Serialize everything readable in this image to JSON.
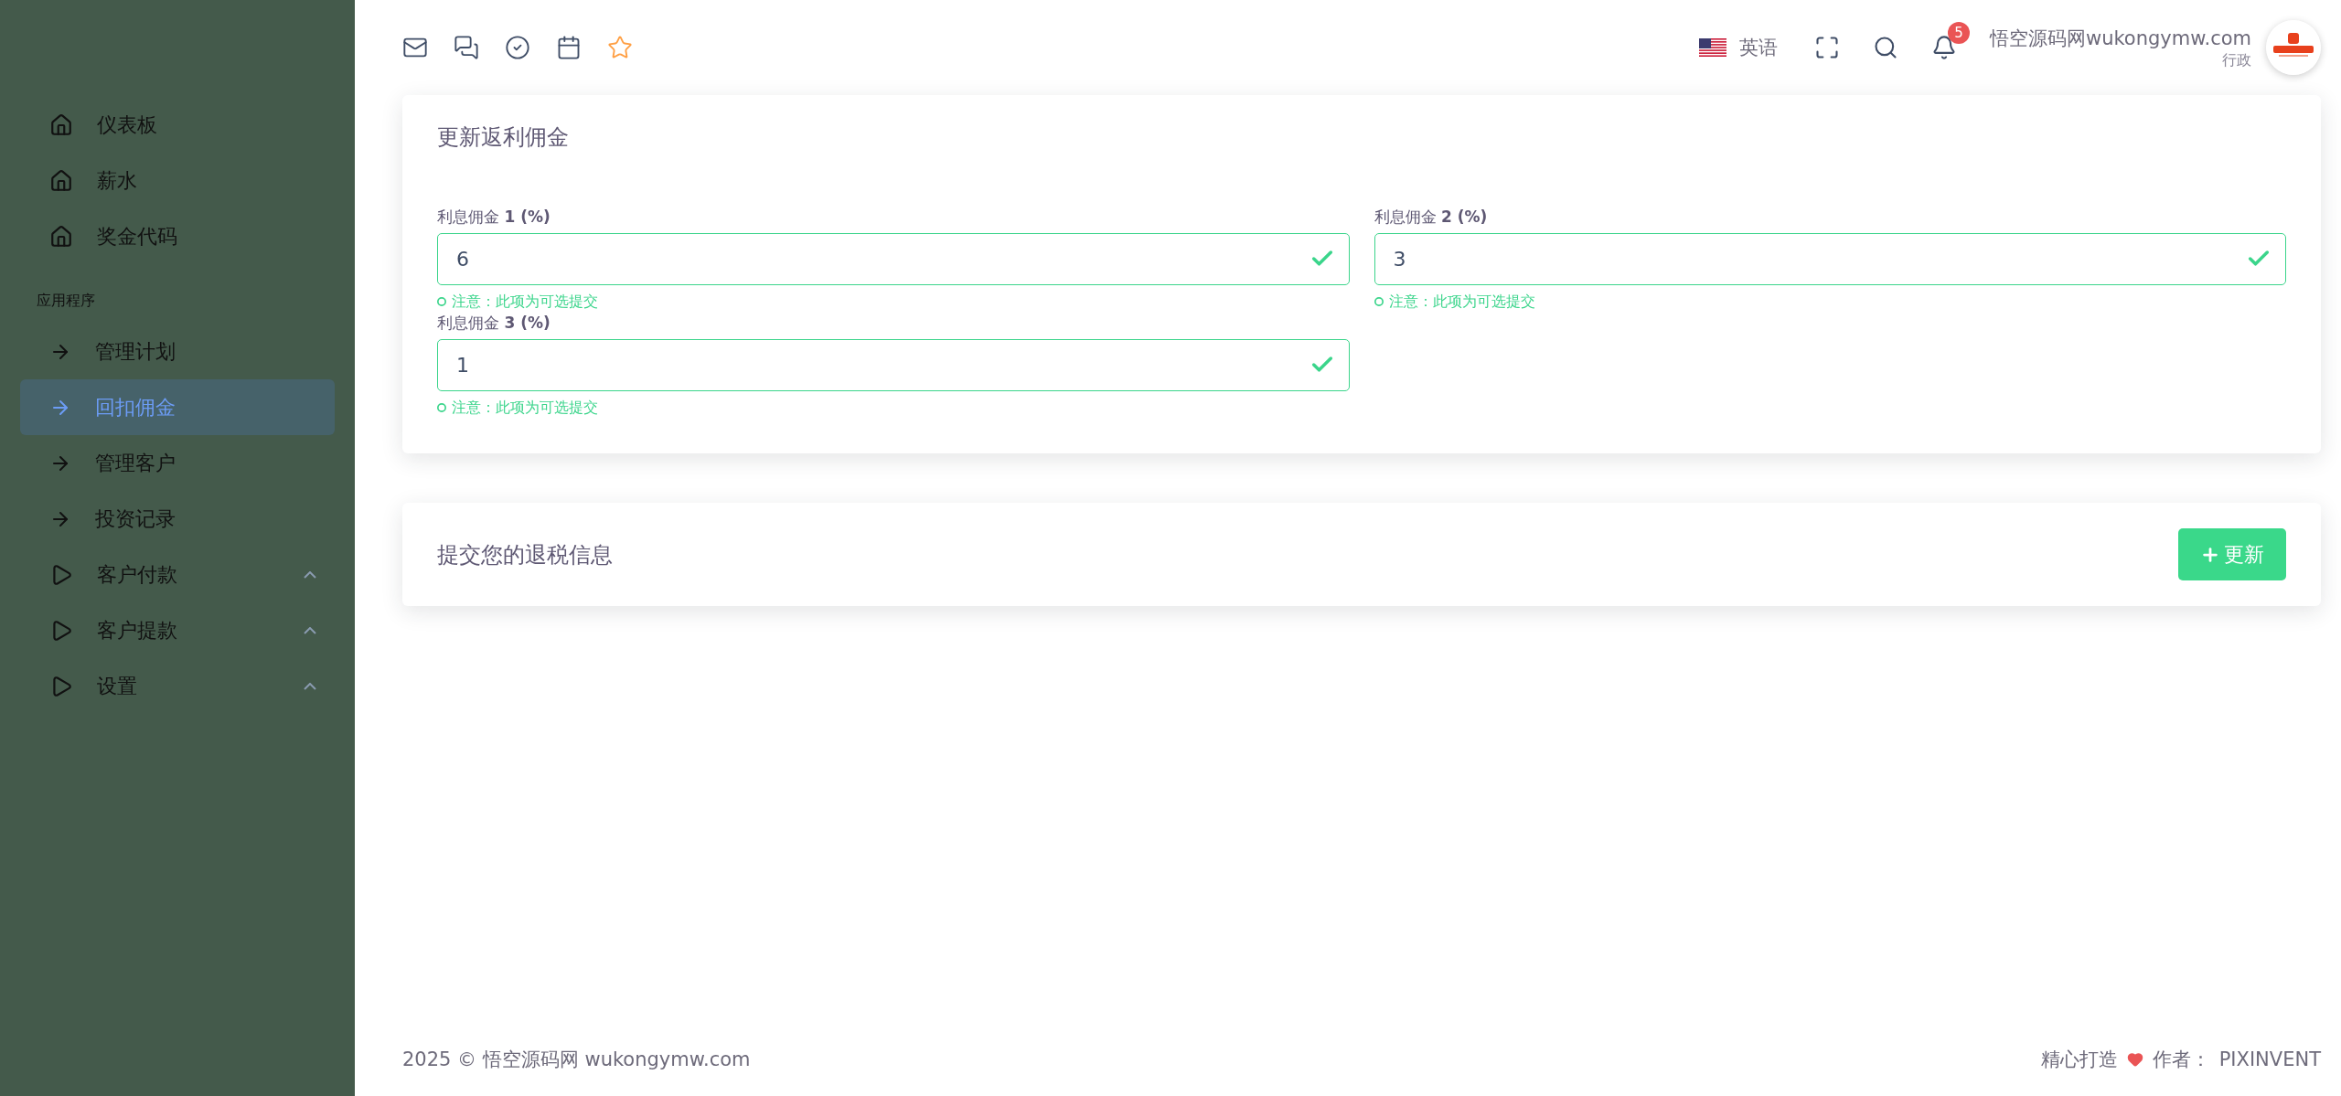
{
  "sidebar": {
    "top_items": [
      {
        "kind": "home",
        "label": "仪表板",
        "selected": false
      },
      {
        "kind": "home",
        "label": "薪水",
        "selected": false
      },
      {
        "kind": "home",
        "label": "奖金代码",
        "selected": false
      }
    ],
    "section": {
      "title": "应用程序",
      "items": [
        {
          "kind": "arrow",
          "label": "管理计划",
          "selected": false
        },
        {
          "kind": "arrow",
          "label": "回扣佣金",
          "selected": true
        },
        {
          "kind": "arrow",
          "label": "管理客户",
          "selected": false
        },
        {
          "kind": "arrow",
          "label": "投资记录",
          "selected": false
        },
        {
          "kind": "group",
          "label": "客户付款",
          "selected": false
        },
        {
          "kind": "group",
          "label": "客户提款",
          "selected": false
        },
        {
          "kind": "group",
          "label": "设置",
          "selected": false
        }
      ]
    }
  },
  "header": {
    "language": "英语",
    "notifications": "5",
    "user": {
      "name": "悟空源码网wukongymw.com",
      "role": "行政"
    }
  },
  "commission_card": {
    "title": "更新返利佣金",
    "fields": [
      {
        "label": "利息佣金 **1 (%)**",
        "value": "6",
        "hint": "注意：此项为可选提交",
        "valid": true
      },
      {
        "label": "利息佣金 **2 (%)**",
        "value": "3",
        "hint": "注意：此项为可选提交",
        "valid": true
      },
      {
        "label": "利息佣金 **3 (%)**",
        "value": "1",
        "hint": "注意：此项为可选提交",
        "valid": true
      }
    ]
  },
  "tax_card": {
    "title": "提交您的退税信息",
    "button": "更新"
  },
  "footer": {
    "copyright": "2025 © 悟空源码网 wukongymw.com",
    "made_with": "精心打造",
    "author_label": "作者：",
    "author": "PIXINVENT"
  }
}
